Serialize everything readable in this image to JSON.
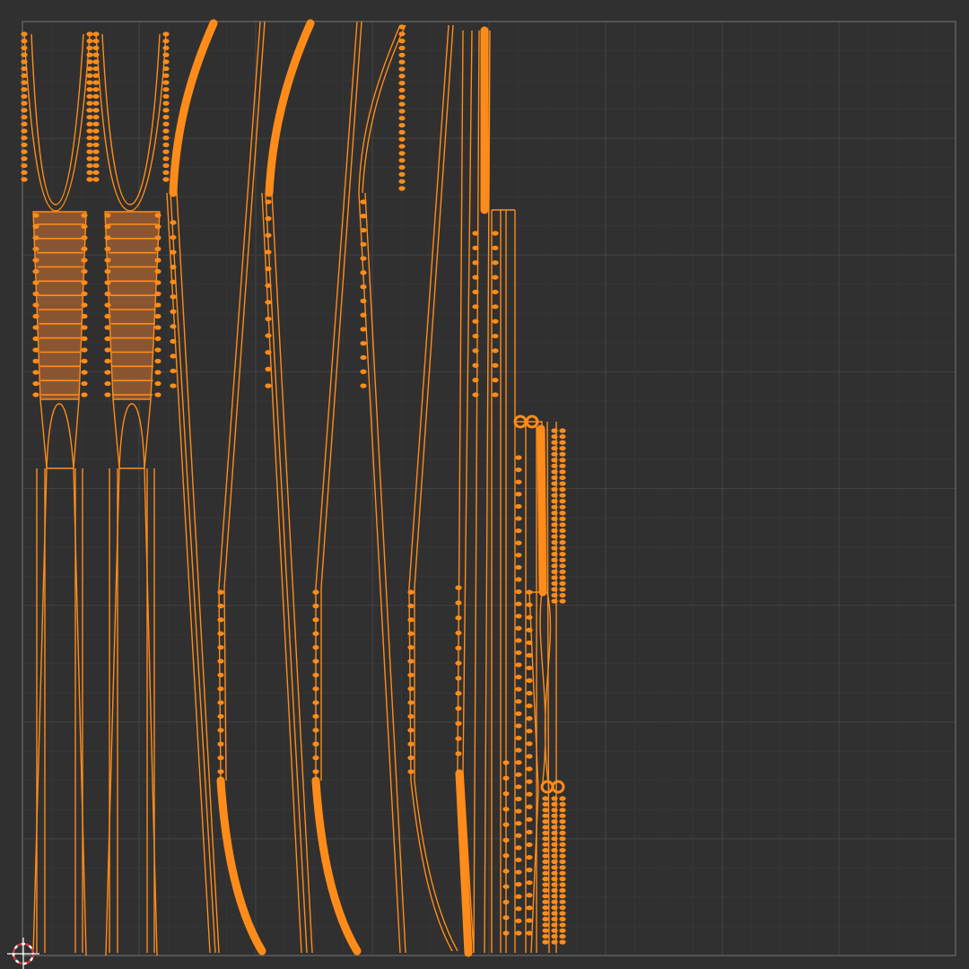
{
  "editor": {
    "background_color": "#303030",
    "bounds_color": "#6b6b6b",
    "grid_minor_color": "#3a3a3a",
    "grid_major_color": "#434343"
  },
  "selection": {
    "edge_color": "#ff8c1a",
    "face_color": "#8a5632",
    "vertex_color": "#ff8c1a"
  },
  "cursor": {
    "icon": "cursor-3d-icon",
    "ring_color": "#ffffff",
    "accent_color": "#d63a3a"
  }
}
